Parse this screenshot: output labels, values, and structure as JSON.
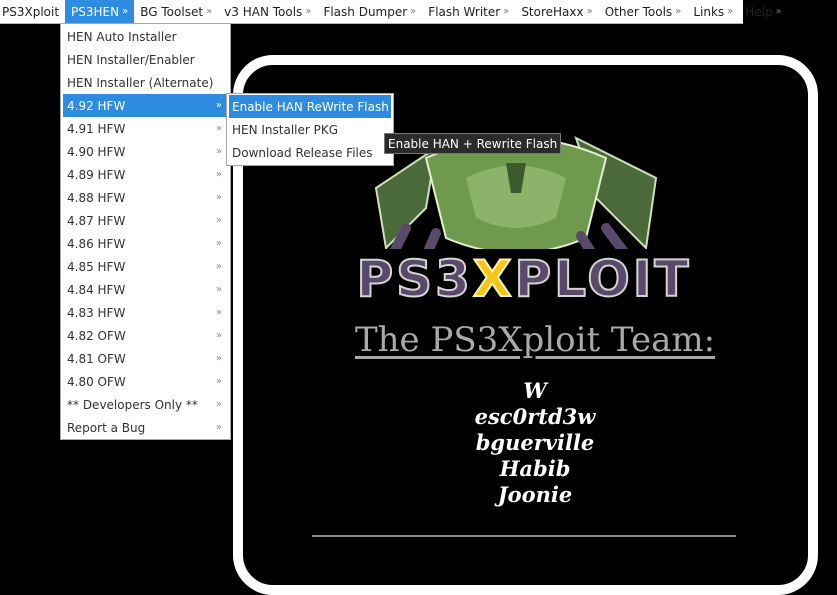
{
  "menubar": {
    "items": [
      {
        "label": "PS3Xploit",
        "arrow": ""
      },
      {
        "label": "PS3HEN",
        "arrow": "»"
      },
      {
        "label": "BG Toolset",
        "arrow": "»"
      },
      {
        "label": "v3 HAN Tools",
        "arrow": "»"
      },
      {
        "label": "Flash Dumper",
        "arrow": "»"
      },
      {
        "label": "Flash Writer",
        "arrow": "»"
      },
      {
        "label": "StoreHaxx",
        "arrow": "»"
      },
      {
        "label": "Other Tools",
        "arrow": "»"
      },
      {
        "label": "Links",
        "arrow": "»"
      },
      {
        "label": "Help",
        "arrow": "»"
      }
    ],
    "active_index": 1
  },
  "dropdown": {
    "items": [
      {
        "label": "HEN Auto Installer",
        "chevron": ""
      },
      {
        "label": "HEN Installer/Enabler",
        "chevron": ""
      },
      {
        "label": "HEN Installer (Alternate)",
        "chevron": ""
      },
      {
        "label": "4.92 HFW",
        "chevron": "»"
      },
      {
        "label": "4.91 HFW",
        "chevron": "»"
      },
      {
        "label": "4.90 HFW",
        "chevron": "»"
      },
      {
        "label": "4.89 HFW",
        "chevron": "»"
      },
      {
        "label": "4.88 HFW",
        "chevron": "»"
      },
      {
        "label": "4.87 HFW",
        "chevron": "»"
      },
      {
        "label": "4.86 HFW",
        "chevron": "»"
      },
      {
        "label": "4.85 HFW",
        "chevron": "»"
      },
      {
        "label": "4.84 HFW",
        "chevron": "»"
      },
      {
        "label": "4.83 HFW",
        "chevron": "»"
      },
      {
        "label": "4.82 OFW",
        "chevron": "»"
      },
      {
        "label": "4.81 OFW",
        "chevron": "»"
      },
      {
        "label": "4.80 OFW",
        "chevron": "»"
      },
      {
        "label": "** Developers Only **",
        "chevron": "»"
      },
      {
        "label": "Report a Bug",
        "chevron": "»"
      }
    ],
    "active_index": 3
  },
  "submenu": {
    "items": [
      {
        "label": "Enable HAN ReWrite Flash"
      },
      {
        "label": "HEN Installer PKG"
      },
      {
        "label": "Download Release Files"
      }
    ],
    "active_index": 0
  },
  "tooltip": {
    "text": "Enable HAN + Rewrite Flash"
  },
  "content": {
    "logo_text": "PS3XPLOIT",
    "team_title": "The PS3Xploit Team:",
    "members": [
      "W",
      "esc0rtd3w",
      "bguerville",
      "Habib",
      "Joonie"
    ]
  },
  "colors": {
    "accent": "#2d8ce0",
    "background": "#000000",
    "panel_border": "#ffffff",
    "title_gray": "#a9a9a9",
    "logo_green": "#6f9a4e",
    "logo_purple": "#5a4a6a",
    "logo_x": "#f5c518"
  }
}
